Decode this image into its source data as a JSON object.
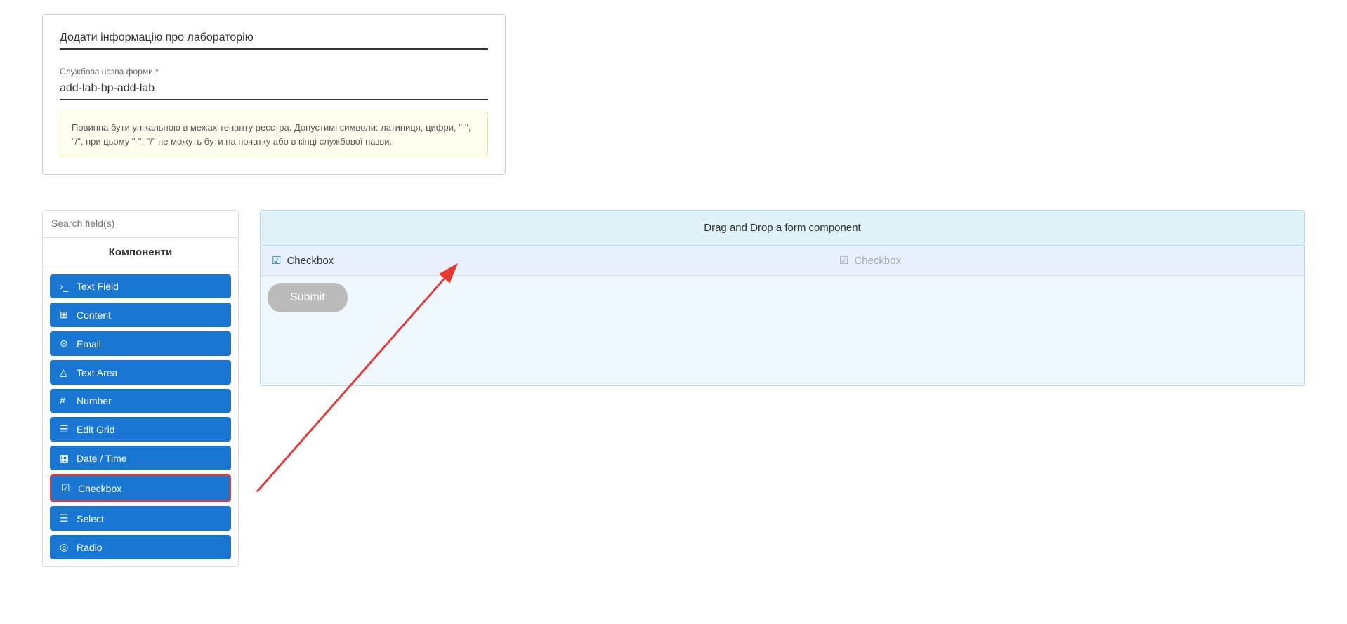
{
  "top_form": {
    "title_placeholder": "Додати інформацію про лабораторію",
    "service_name_label": "Службова назва форми *",
    "service_name_value": "add-lab-bp-add-lab",
    "hint_text": "Повинна бути унікальною в межах тенанту реєстра. Допустимі символи: латиниця, цифри, \"-\", \"/\", при цьому \"-\", \"/\" не можуть бути на початку або в кінці службової назви."
  },
  "sidebar": {
    "search_placeholder": "Search field(s)",
    "components_header": "Компоненти",
    "items": [
      {
        "id": "text-field",
        "label": "Text Field",
        "icon": "›_"
      },
      {
        "id": "content",
        "label": "Content",
        "icon": "⊞"
      },
      {
        "id": "email",
        "label": "Email",
        "icon": "⊙"
      },
      {
        "id": "text-area",
        "label": "Text Area",
        "icon": "△"
      },
      {
        "id": "number",
        "label": "Number",
        "icon": "#"
      },
      {
        "id": "edit-grid",
        "label": "Edit Grid",
        "icon": "☰"
      },
      {
        "id": "date-time",
        "label": "Date / Time",
        "icon": "📅"
      },
      {
        "id": "checkbox",
        "label": "Checkbox",
        "icon": "☑",
        "highlighted": true
      },
      {
        "id": "select",
        "label": "Select",
        "icon": "≡"
      },
      {
        "id": "radio",
        "label": "Radio",
        "icon": "◎"
      }
    ]
  },
  "drop_zone": {
    "banner_text": "Drag and Drop a form component",
    "checkbox_label": "Checkbox",
    "checkbox_preview_label": "Checkbox",
    "submit_label": "Submit"
  },
  "colors": {
    "btn_blue": "#1976d2",
    "banner_bg": "#d9eef5",
    "checkbox_highlight_border": "#e53935",
    "submit_gray": "#bbb",
    "arrow_red": "#e53935"
  }
}
